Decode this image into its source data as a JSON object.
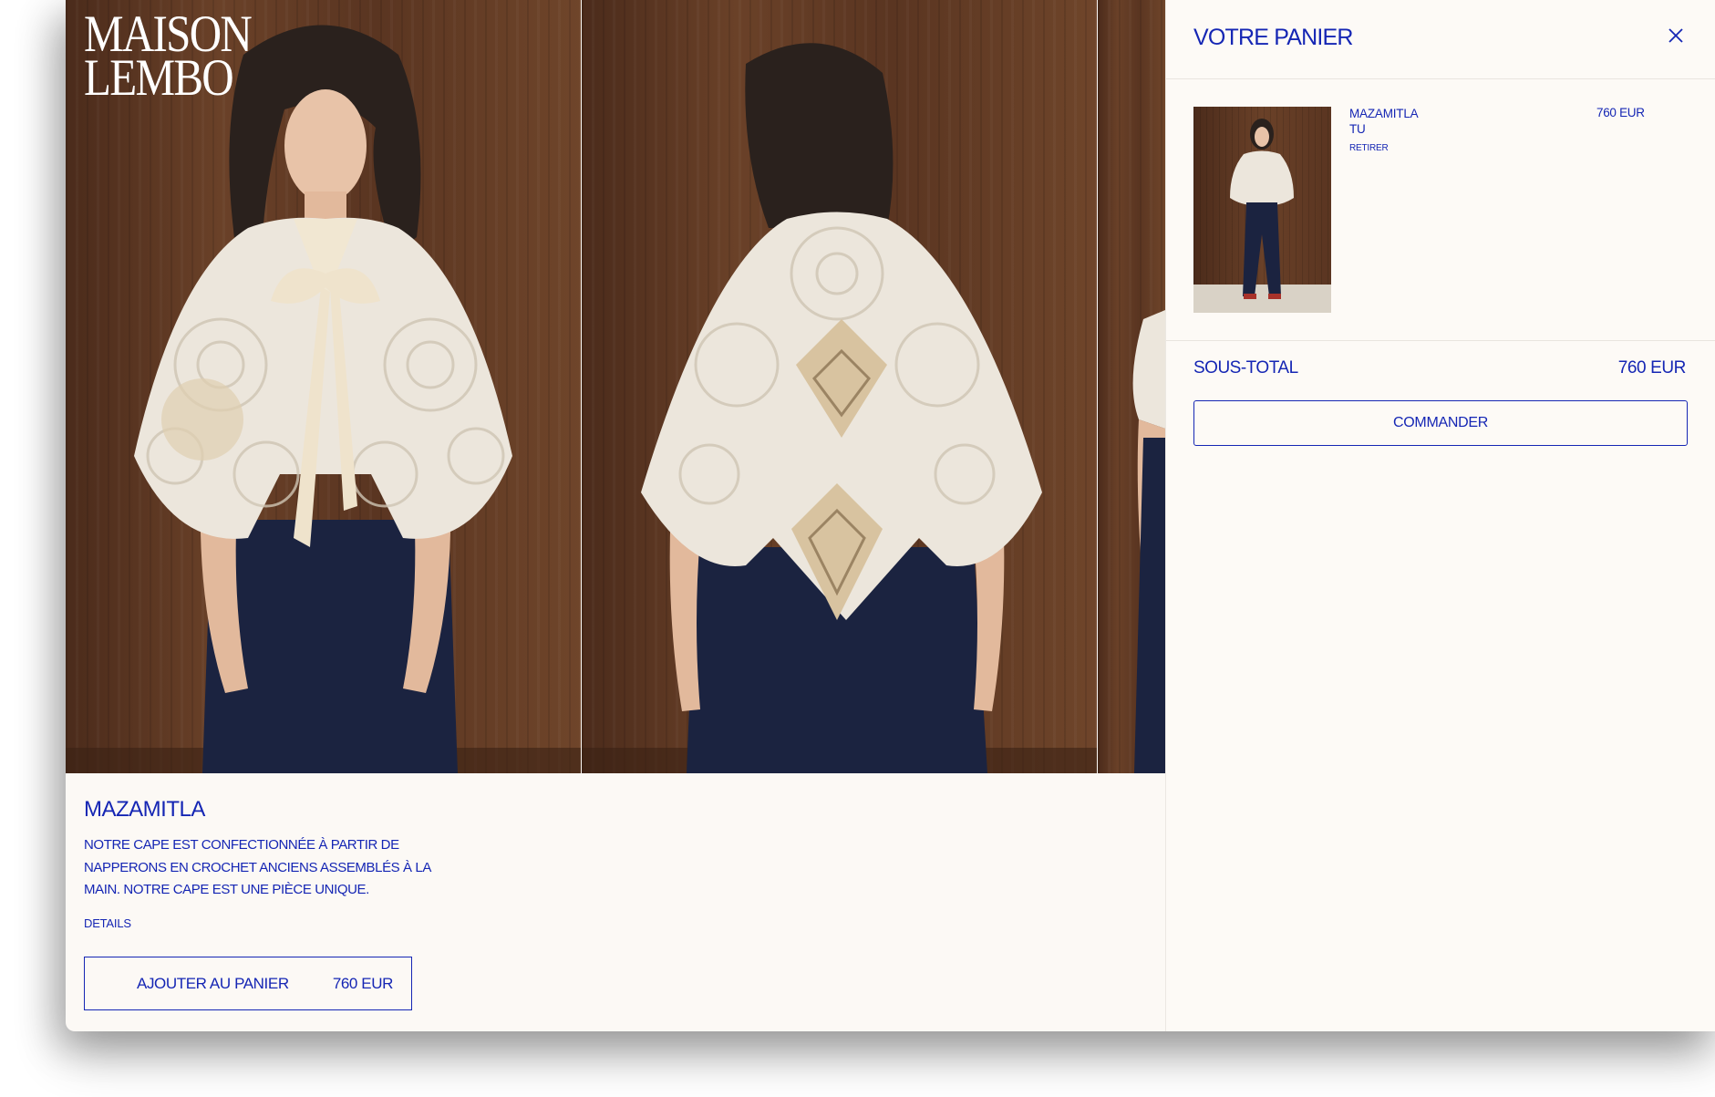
{
  "brand": {
    "logo_line1": "MAISON",
    "logo_line2": "LEMBO"
  },
  "product": {
    "name": "MAZAMITLA",
    "description": "NOTRE CAPE EST CONFECTIONNÉE À PARTIR DE NAPPERONS EN CROCHET ANCIENS ASSEMBLÉS À LA MAIN. NOTRE CAPE EST UNE PIÈCE UNIQUE.",
    "details_label": "DETAILS",
    "add_to_cart_label": "AJOUTER AU PANIER",
    "price": "760 EUR"
  },
  "cart": {
    "title": "VOTRE PANIER",
    "items": [
      {
        "name": "MAZAMITLA",
        "size": "TU",
        "remove_label": "RETIRER",
        "price": "760 EUR"
      }
    ],
    "subtotal_label": "SOUS-TOTAL",
    "subtotal_value": "760 EUR",
    "checkout_label": "COMMANDER"
  },
  "colors": {
    "accent": "#1526b4",
    "background": "#fcf9f5",
    "logo": "#ffffff"
  },
  "icons": {
    "close": "close-icon"
  }
}
